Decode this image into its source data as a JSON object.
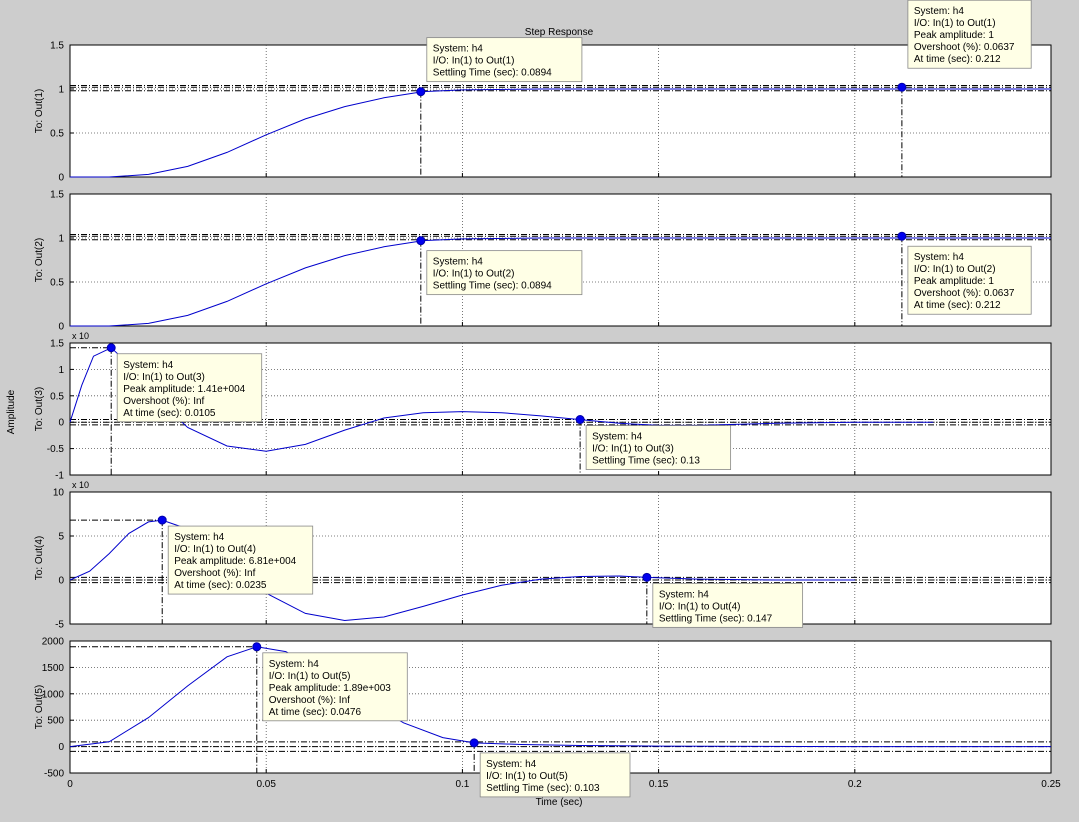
{
  "figure": {
    "title": "Step Response",
    "xlabel": "Time (sec)",
    "ylabel": "Amplitude",
    "xlim": [
      0,
      0.25
    ],
    "xticks": [
      0,
      0.05,
      0.1,
      0.15,
      0.2,
      0.25
    ],
    "xtick_labels": [
      "0",
      "0.05",
      "0.1",
      "0.15",
      "0.2",
      "0.25"
    ],
    "background": "#cdcdcd",
    "axes_bg": "#ffffff",
    "line_color": "#0000cc",
    "marker_color": "#0000ee",
    "tooltip_bg": "#ffffe6"
  },
  "chart_data": [
    {
      "type": "line",
      "ylabel": "To: Out(1)",
      "ylim": [
        0,
        1.5
      ],
      "yticks": [
        0,
        0.5,
        1,
        1.5
      ],
      "ytick_labels": [
        "0",
        "0.5",
        "1",
        "1.5"
      ],
      "exponent": "",
      "hlines": [
        0.98,
        1.02,
        1.04
      ],
      "series": [
        {
          "x": [
            0,
            0.01,
            0.02,
            0.03,
            0.04,
            0.05,
            0.06,
            0.07,
            0.08,
            0.09,
            0.1,
            0.12,
            0.15,
            0.2,
            0.25
          ],
          "y": [
            0,
            0,
            0.03,
            0.12,
            0.28,
            0.48,
            0.66,
            0.8,
            0.9,
            0.97,
            0.99,
            1.0,
            1.0,
            1.0,
            1.0
          ]
        }
      ],
      "markers": [
        {
          "x": 0.0894,
          "y": 0.97,
          "vline": true
        },
        {
          "x": 0.212,
          "y": 1.02,
          "vline": true
        }
      ],
      "tooltips": [
        {
          "lines": [
            "System: h4",
            "I/O: In(1) to Out(1)",
            "Settling Time (sec): 0.0894"
          ],
          "anchor": "above"
        },
        {
          "lines": [
            "System: h4",
            "I/O: In(1) to Out(1)",
            "Peak amplitude: 1",
            "Overshoot (%): 0.0637",
            "At time (sec): 0.212"
          ],
          "anchor": "above"
        }
      ]
    },
    {
      "type": "line",
      "ylabel": "To: Out(2)",
      "ylim": [
        0,
        1.5
      ],
      "yticks": [
        0,
        0.5,
        1,
        1.5
      ],
      "ytick_labels": [
        "0",
        "0.5",
        "1",
        "1.5"
      ],
      "exponent": "",
      "hlines": [
        0.98,
        1.02,
        1.04
      ],
      "series": [
        {
          "x": [
            0,
            0.01,
            0.02,
            0.03,
            0.04,
            0.05,
            0.06,
            0.07,
            0.08,
            0.09,
            0.1,
            0.12,
            0.15,
            0.2,
            0.25
          ],
          "y": [
            0,
            0,
            0.03,
            0.12,
            0.28,
            0.48,
            0.66,
            0.8,
            0.9,
            0.97,
            0.99,
            1.0,
            1.0,
            1.0,
            1.0
          ]
        }
      ],
      "markers": [
        {
          "x": 0.0894,
          "y": 0.97,
          "vline": true
        },
        {
          "x": 0.212,
          "y": 1.02,
          "vline": true
        }
      ],
      "tooltips": [
        {
          "lines": [
            "System: h4",
            "I/O: In(1) to Out(2)",
            "Settling Time (sec): 0.0894"
          ],
          "anchor": "below"
        },
        {
          "lines": [
            "System: h4",
            "I/O: In(1) to Out(2)",
            "Peak amplitude: 1",
            "Overshoot (%): 0.0637",
            "At time (sec): 0.212"
          ],
          "anchor": "below"
        }
      ]
    },
    {
      "type": "line",
      "ylabel": "To: Out(3)",
      "ylim": [
        -1,
        1.5
      ],
      "yticks": [
        -1,
        -0.5,
        0,
        0.5,
        1,
        1.5
      ],
      "ytick_labels": [
        "-1",
        "-0.5",
        "0",
        "0.5",
        "1",
        "1.5"
      ],
      "exponent": "x 10",
      "hlines": [
        -0.05,
        0,
        0.05
      ],
      "series": [
        {
          "x": [
            0,
            0.003,
            0.006,
            0.0105,
            0.015,
            0.02,
            0.03,
            0.04,
            0.05,
            0.06,
            0.07,
            0.08,
            0.09,
            0.1,
            0.11,
            0.12,
            0.13,
            0.14,
            0.15,
            0.16,
            0.18,
            0.2,
            0.22
          ],
          "y": [
            0,
            0.7,
            1.25,
            1.41,
            1.1,
            0.6,
            -0.1,
            -0.45,
            -0.55,
            -0.42,
            -0.15,
            0.08,
            0.18,
            0.2,
            0.18,
            0.12,
            0.05,
            -0.02,
            -0.06,
            -0.06,
            -0.02,
            0,
            0
          ]
        }
      ],
      "markers": [
        {
          "x": 0.0105,
          "y": 1.41,
          "vline": true
        },
        {
          "x": 0.13,
          "y": 0.05,
          "vline": true
        }
      ],
      "tooltips": [
        {
          "lines": [
            "System: h4",
            "I/O: In(1) to Out(3)",
            "Peak amplitude: 1.41e+004",
            "Overshoot (%): Inf",
            "At time (sec): 0.0105"
          ],
          "anchor": "below"
        },
        {
          "lines": [
            "System: h4",
            "I/O: In(1) to Out(3)",
            "Settling Time (sec): 0.13"
          ],
          "anchor": "below"
        }
      ]
    },
    {
      "type": "line",
      "ylabel": "To: Out(4)",
      "ylim": [
        -5,
        10
      ],
      "yticks": [
        -5,
        0,
        5,
        10
      ],
      "ytick_labels": [
        "-5",
        "0",
        "5",
        "10"
      ],
      "exponent": "x 10",
      "hlines": [
        -0.3,
        0,
        0.3
      ],
      "series": [
        {
          "x": [
            0,
            0.005,
            0.01,
            0.015,
            0.02,
            0.0235,
            0.03,
            0.04,
            0.05,
            0.06,
            0.07,
            0.08,
            0.09,
            0.1,
            0.11,
            0.12,
            0.13,
            0.14,
            0.147,
            0.16,
            0.18,
            0.2
          ],
          "y": [
            0,
            1,
            3,
            5.3,
            6.6,
            6.81,
            5.8,
            2.5,
            -1.5,
            -3.8,
            -4.6,
            -4.2,
            -3.0,
            -1.7,
            -0.6,
            0.1,
            0.4,
            0.45,
            0.3,
            0.1,
            0,
            0
          ]
        }
      ],
      "markers": [
        {
          "x": 0.0235,
          "y": 6.81,
          "vline": true
        },
        {
          "x": 0.147,
          "y": 0.3,
          "vline": true
        }
      ],
      "tooltips": [
        {
          "lines": [
            "System: h4",
            "I/O: In(1) to Out(4)",
            "Peak amplitude: 6.81e+004",
            "Overshoot (%): Inf",
            "At time (sec): 0.0235"
          ],
          "anchor": "below"
        },
        {
          "lines": [
            "System: h4",
            "I/O: In(1) to Out(4)",
            "Settling Time (sec): 0.147"
          ],
          "anchor": "below"
        }
      ]
    },
    {
      "type": "line",
      "ylabel": "To: Out(5)",
      "ylim": [
        -500,
        2000
      ],
      "yticks": [
        -500,
        0,
        500,
        1000,
        1500,
        2000
      ],
      "ytick_labels": [
        "-500",
        "0",
        "500",
        "1000",
        "1500",
        "2000"
      ],
      "exponent": "",
      "hlines": [
        -90,
        0,
        90
      ],
      "series": [
        {
          "x": [
            0,
            0.01,
            0.02,
            0.03,
            0.04,
            0.0476,
            0.055,
            0.065,
            0.075,
            0.085,
            0.095,
            0.103,
            0.115,
            0.13,
            0.15,
            0.2,
            0.25
          ],
          "y": [
            0,
            90,
            550,
            1150,
            1700,
            1890,
            1800,
            1380,
            900,
            450,
            170,
            70,
            40,
            20,
            10,
            0,
            0
          ]
        }
      ],
      "markers": [
        {
          "x": 0.0476,
          "y": 1890,
          "vline": true
        },
        {
          "x": 0.103,
          "y": 70,
          "vline": true
        }
      ],
      "tooltips": [
        {
          "lines": [
            "System: h4",
            "I/O: In(1) to Out(5)",
            "Peak amplitude: 1.89e+003",
            "Overshoot (%): Inf",
            "At time (sec): 0.0476"
          ],
          "anchor": "below"
        },
        {
          "lines": [
            "System: h4",
            "I/O: In(1) to Out(5)",
            "Settling Time (sec): 0.103"
          ],
          "anchor": "below"
        }
      ]
    }
  ]
}
